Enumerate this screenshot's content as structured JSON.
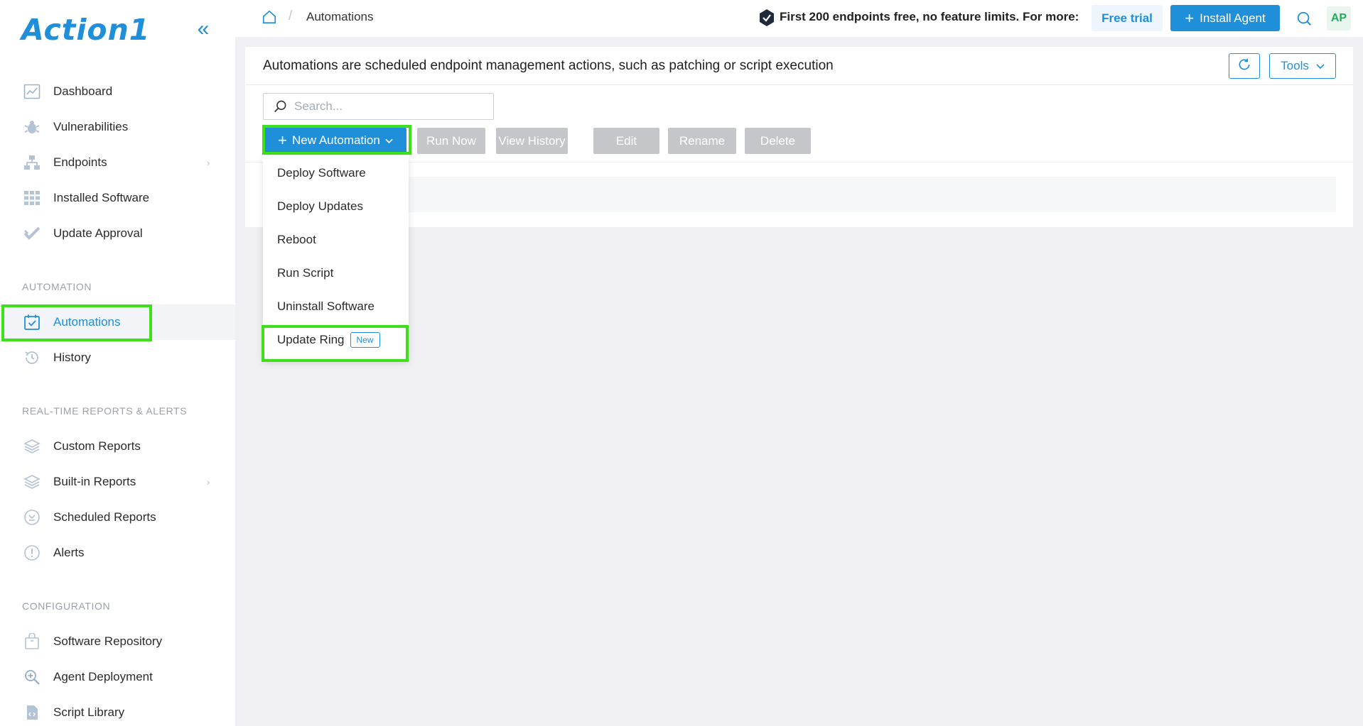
{
  "sidebar": {
    "logo": "Action1",
    "collapse_icon": "double-chevron-left-icon",
    "main_items": [
      {
        "label": "Dashboard",
        "icon": "dashboard-icon"
      },
      {
        "label": "Vulnerabilities",
        "icon": "bug-icon"
      },
      {
        "label": "Endpoints",
        "icon": "network-icon",
        "expandable": true
      },
      {
        "label": "Installed Software",
        "icon": "grid-icon"
      },
      {
        "label": "Update Approval",
        "icon": "check-icon"
      }
    ],
    "sections": [
      {
        "title": "AUTOMATION",
        "items": [
          {
            "label": "Automations",
            "icon": "calendar-check-icon",
            "active": true
          },
          {
            "label": "History",
            "icon": "history-icon"
          }
        ]
      },
      {
        "title": "REAL-TIME REPORTS & ALERTS",
        "items": [
          {
            "label": "Custom Reports",
            "icon": "layers-icon"
          },
          {
            "label": "Built-in Reports",
            "icon": "layers-icon",
            "expandable": true
          },
          {
            "label": "Scheduled Reports",
            "icon": "clock-icon"
          },
          {
            "label": "Alerts",
            "icon": "alert-icon"
          }
        ]
      },
      {
        "title": "CONFIGURATION",
        "items": [
          {
            "label": "Software Repository",
            "icon": "package-icon"
          },
          {
            "label": "Agent Deployment",
            "icon": "search-plus-icon"
          },
          {
            "label": "Script Library",
            "icon": "script-icon"
          }
        ]
      }
    ]
  },
  "topbar": {
    "breadcrumb_separator": "/",
    "breadcrumb": "Automations",
    "promo_text": "First 200 endpoints free, no feature limits. For more:",
    "free_trial_label": "Free trial",
    "install_agent_label": "Install Agent",
    "avatar_initials": "AP"
  },
  "main": {
    "title": "Automations are scheduled endpoint management actions, such as patching or script execution",
    "tools_label": "Tools",
    "search_placeholder": "Search...",
    "new_automation_label": "New Automation",
    "actions": [
      "Run Now",
      "View History",
      "Edit",
      "Rename",
      "Delete"
    ]
  },
  "dropdown": {
    "items": [
      {
        "label": "Deploy Software"
      },
      {
        "label": "Deploy Updates"
      },
      {
        "label": "Reboot"
      },
      {
        "label": "Run Script"
      },
      {
        "label": "Uninstall Software"
      },
      {
        "label": "Update Ring",
        "badge": "New"
      }
    ]
  },
  "colors": {
    "accent": "#1e8fd8",
    "highlight": "#3ee01b",
    "background": "#f0f0f4",
    "disabled": "#c4c6ca"
  }
}
